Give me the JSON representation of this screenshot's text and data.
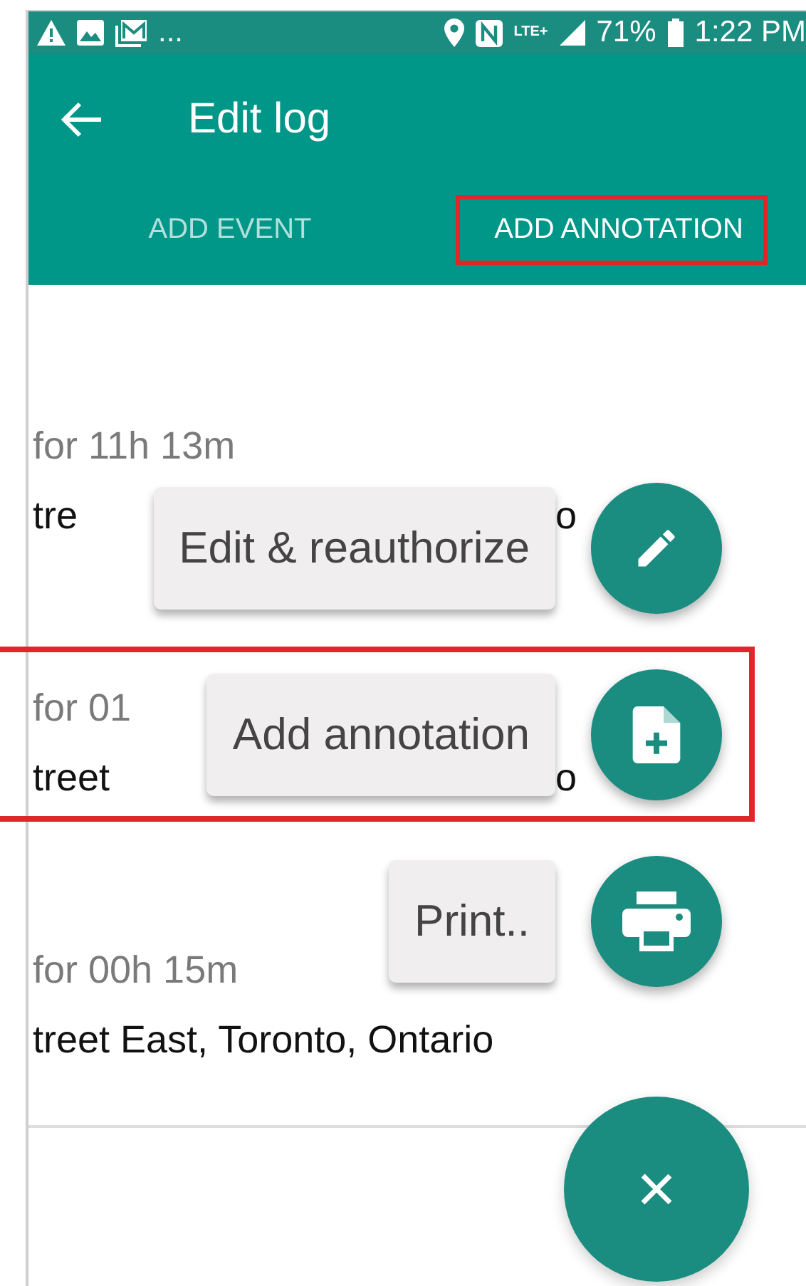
{
  "status_bar": {
    "more_notifications": "...",
    "network": "LTE+",
    "battery": "71%",
    "time": "1:22 PM"
  },
  "toolbar": {
    "title": "Edit log"
  },
  "tabs": [
    {
      "label": "ADD EVENT",
      "selected": false,
      "highlighted": false
    },
    {
      "label": "ADD ANNOTATION",
      "selected": true,
      "highlighted": true
    }
  ],
  "log_entries": [
    {
      "duration": "for 11h 13m",
      "address": [
        "tre",
        "o"
      ]
    },
    {
      "duration": "for 01",
      "address": [
        "treet",
        "o"
      ]
    },
    {
      "duration": "for 00h 15m",
      "address": [
        "treet East, Toronto, Ontario"
      ]
    }
  ],
  "fab_actions": [
    {
      "label": "Edit & reauthorize",
      "kind": "edit",
      "highlighted": false
    },
    {
      "label": "Add annotation",
      "kind": "annotate",
      "highlighted": true
    },
    {
      "label": "Print..",
      "kind": "print",
      "highlighted": false
    }
  ],
  "fab": {
    "symbol": "×"
  }
}
